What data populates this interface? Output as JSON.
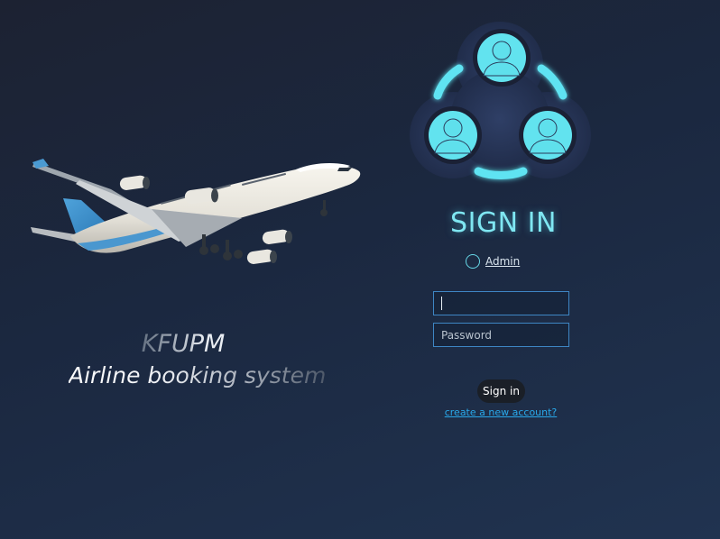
{
  "branding": {
    "title": "KFUPM",
    "subtitle": "Airline booking system"
  },
  "login": {
    "heading": "SIGN IN",
    "admin_label": "Admin",
    "username_value": "",
    "password_placeholder": "Password",
    "signin_label": "Sign in",
    "create_account_label": "create a new account?"
  },
  "icons": {
    "hero_image": "airplane-image",
    "login_icon": "users-group-icon"
  },
  "colors": {
    "accent": "#7fe7f2",
    "link": "#29a8ea",
    "input_border": "#3e86c4"
  }
}
